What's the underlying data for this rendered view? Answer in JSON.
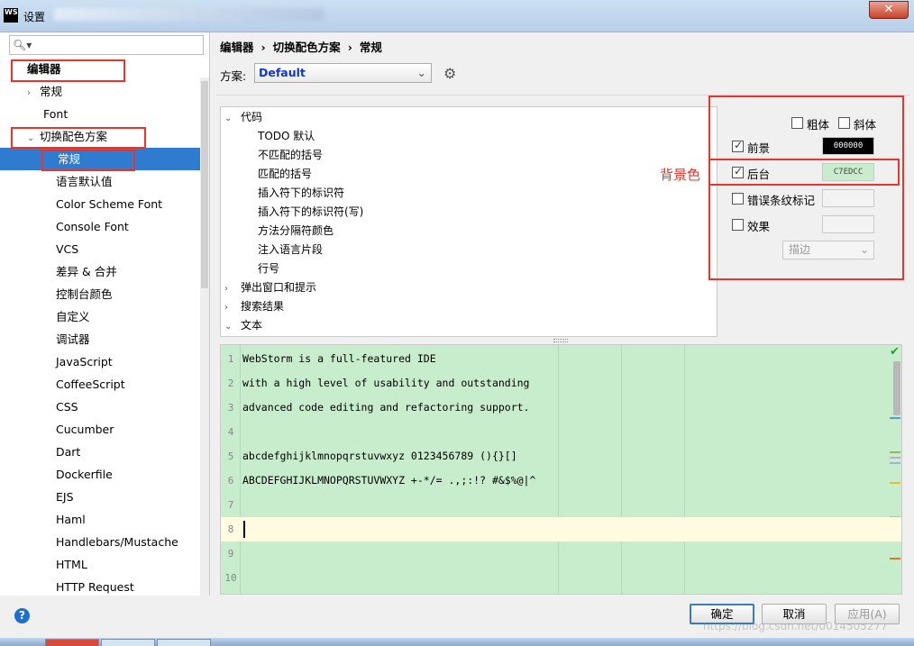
{
  "window": {
    "title": "设置",
    "logo_text": "WS"
  },
  "search": {
    "placeholder": ""
  },
  "left_tree": [
    {
      "label": "编辑器",
      "bold": true
    },
    {
      "label": "常规",
      "arrow": "›"
    },
    {
      "label": "Font"
    },
    {
      "label": "切换配色方案",
      "arrow": "⌄"
    },
    {
      "label": "常规",
      "selected": true
    },
    {
      "label": "语言默认值"
    },
    {
      "label": "Color Scheme Font"
    },
    {
      "label": "Console Font"
    },
    {
      "label": "VCS"
    },
    {
      "label": "差异 & 合并"
    },
    {
      "label": "控制台颜色"
    },
    {
      "label": "自定义"
    },
    {
      "label": "调试器"
    },
    {
      "label": "JavaScript"
    },
    {
      "label": "CoffeeScript"
    },
    {
      "label": "CSS"
    },
    {
      "label": "Cucumber"
    },
    {
      "label": "Dart"
    },
    {
      "label": "Dockerfile"
    },
    {
      "label": "EJS"
    },
    {
      "label": "Haml"
    },
    {
      "label": "Handlebars/Mustache"
    },
    {
      "label": "HTML"
    },
    {
      "label": "HTTP Request"
    }
  ],
  "breadcrumb": [
    "编辑器",
    "›",
    "切换配色方案",
    "›",
    "常规"
  ],
  "scheme": {
    "label": "方案:",
    "value": "Default"
  },
  "option_tree": [
    {
      "label": "代码",
      "arrow": "⌄"
    },
    {
      "label": "TODO 默认"
    },
    {
      "label": "不匹配的括号"
    },
    {
      "label": "匹配的括号"
    },
    {
      "label": "插入符下的标识符"
    },
    {
      "label": "插入符下的标识符(写)"
    },
    {
      "label": "方法分隔符颜色"
    },
    {
      "label": "注入语言片段"
    },
    {
      "label": "行号"
    },
    {
      "label": "弹出窗口和提示",
      "arrow": "›"
    },
    {
      "label": "搜索结果",
      "arrow": "›"
    },
    {
      "label": "文本",
      "arrow": "⌄"
    }
  ],
  "attributes": {
    "bold": {
      "label": "粗体",
      "checked": false
    },
    "italic": {
      "label": "斜体",
      "checked": false
    },
    "foreground": {
      "label": "前景",
      "checked": true,
      "value": "000000",
      "color": "#000000"
    },
    "background": {
      "label": "后台",
      "checked": true,
      "value": "C7EDCC",
      "color": "#c7edcc"
    },
    "error_stripe": {
      "label": "错误条纹标记",
      "checked": false
    },
    "effects": {
      "label": "效果",
      "checked": false
    },
    "effect_type": "描边"
  },
  "annotation": "背景色",
  "editor": {
    "lines": [
      {
        "no": "1",
        "text": "WebStorm is a full-featured IDE"
      },
      {
        "no": "2",
        "text": "with a high level of usability and outstanding"
      },
      {
        "no": "3",
        "text": "advanced code editing and refactoring support."
      },
      {
        "no": "4",
        "text": ""
      },
      {
        "no": "5",
        "text": "abcdefghijklmnopqrstuvwxyz 0123456789 (){}[]"
      },
      {
        "no": "6",
        "text": "ABCDEFGHIJKLMNOPQRSTUVWXYZ +-*/= .,;:!? #&$%@|^"
      },
      {
        "no": "7",
        "text": ""
      },
      {
        "no": "8",
        "text": "",
        "current": true
      },
      {
        "no": "9",
        "text": ""
      },
      {
        "no": "10",
        "text": ""
      }
    ]
  },
  "buttons": {
    "ok": "确定",
    "cancel": "取消",
    "apply": "应用(A)"
  },
  "watermark": "https://blog.csdn.net/u014505277"
}
